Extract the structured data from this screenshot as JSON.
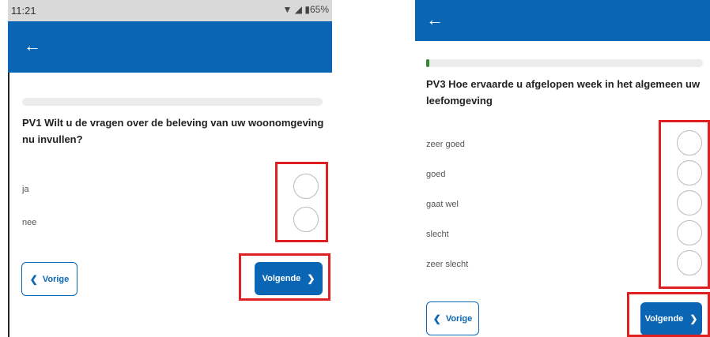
{
  "screen1": {
    "status": {
      "time": "11:21",
      "battery": "65%"
    },
    "question": "PV1 Wilt u de vragen over de beleving van uw woonomgeving nu invullen?",
    "options": [
      "ja",
      "nee"
    ],
    "prev_label": "Vorige",
    "next_label": "Volgende"
  },
  "screen2": {
    "question": "PV3 Hoe ervaarde u afgelopen week in het algemeen uw leefomgeving",
    "options": [
      "zeer goed",
      "goed",
      "gaat wel",
      "slecht",
      "zeer slecht"
    ],
    "prev_label": "Vorige",
    "next_label": "Volgende",
    "progress_fraction": 0.01
  },
  "colors": {
    "brand": "#0a66b5",
    "highlight": "#e02020",
    "progress": "#2e8b2e"
  },
  "icons": {
    "back": "arrow-left-icon",
    "prev": "chevron-left-icon",
    "next": "chevron-right-icon"
  }
}
